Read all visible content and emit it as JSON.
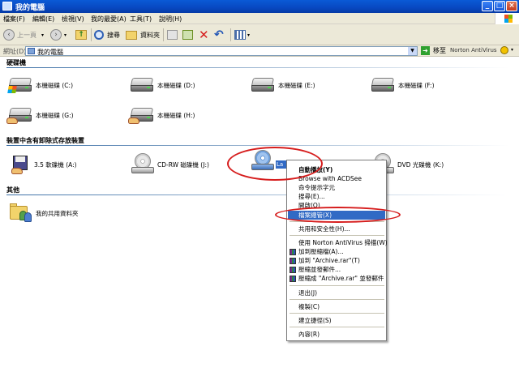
{
  "window": {
    "title": "我的電腦"
  },
  "menubar": [
    "檔案(F)",
    "編輯(E)",
    "檢視(V)",
    "我的最愛(A)",
    "工具(T)",
    "說明(H)"
  ],
  "toolbar": {
    "back_label": "上一頁",
    "search_label": "搜尋",
    "folders_label": "資料夾"
  },
  "address": {
    "label": "網址(D)",
    "value": "我的電腦",
    "go_label": "移至",
    "norton_label": "Norton AntiVirus"
  },
  "groups": {
    "hard_disks": "硬碟機",
    "removable": "裝置中含有卸除式存放裝置",
    "other": "其他"
  },
  "drives": [
    {
      "label": "本機磁碟 (C:)"
    },
    {
      "label": "本機磁碟 (D:)"
    },
    {
      "label": "本機磁碟 (E:)"
    },
    {
      "label": "本機磁碟 (F:)"
    },
    {
      "label": "本機磁碟 (G:)"
    },
    {
      "label": "本機磁碟 (H:)"
    }
  ],
  "removable": [
    {
      "label": "3.5 軟碟機 (A:)"
    },
    {
      "label": "CD-RW 磁碟機 (J:)"
    },
    {
      "label": "La"
    },
    {
      "label": "DVD 光碟機 (K:)"
    }
  ],
  "other": [
    {
      "label": "我的共用資料夾"
    }
  ],
  "context_menu": [
    {
      "label": "自動播放(Y)",
      "bold": true
    },
    {
      "label": "Browse with ACDSee"
    },
    {
      "label": "命令提示字元"
    },
    {
      "label": "搜尋(E)..."
    },
    {
      "label": "開啟(O)"
    },
    {
      "label": "檔案總管(X)",
      "highlighted": true
    },
    {
      "label": "共用和安全性(H)..."
    },
    {
      "label": "使用 Norton AntiVirus 掃描(W)"
    },
    {
      "label": "加到壓縮檔(A)...",
      "rar": true
    },
    {
      "label": "加到 \"Archive.rar\"(T)",
      "rar": true
    },
    {
      "label": "壓縮並發郵件...",
      "rar": true
    },
    {
      "label": "壓縮成 \"Archive.rar\" 並發郵件",
      "rar": true
    },
    {
      "label": "退出(J)"
    },
    {
      "label": "複製(C)"
    },
    {
      "label": "建立捷徑(S)"
    },
    {
      "label": "內容(R)"
    }
  ],
  "colors": {
    "titlebar": "#0a5ad6",
    "selection": "#316ac5",
    "annotation": "#d61d1d"
  }
}
